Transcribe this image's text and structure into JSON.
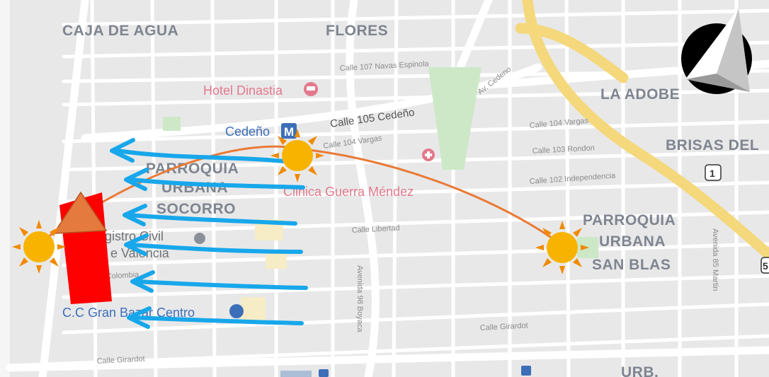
{
  "map": {
    "districts": [
      "CAJA DE AGUA",
      "FLORES",
      "LA ADOBE",
      "BRISAS DEL",
      "PARROQUIA",
      "URBANA",
      "SOCORRO",
      "PARROQUIA",
      "URBANA",
      "SAN BLAS",
      "URB."
    ],
    "streets": [
      "Calle 107 Navas Espinola",
      "Av. Cedeno",
      "Calle 105 Cedeño",
      "Calle 104 Vargas",
      "Calle 104 Vargas",
      "Calle 103 Rondon",
      "Calle 102 Independencia",
      "Calle Libertad",
      "Avenida 98 Boyaca",
      "Calle Girardot",
      "Calle Girardot",
      "Colombia",
      "Avenida 85 Martin"
    ],
    "pois": {
      "hotel": "Hotel Dinastia",
      "metro": "Cedeño",
      "clinic": "Clinica Guerra Méndez",
      "registry_1": "gistro Civil",
      "registry_2": "e Valencia",
      "mall": "C.C Gran Bazar Centro"
    },
    "route_shield": "1",
    "edge_shield": "5"
  },
  "overlay": {
    "icons": [
      "compass-icon",
      "sun-icon",
      "house-icon",
      "wind-arrow-icon"
    ],
    "colors": {
      "sun": "#f7b300",
      "sun_rays": "#f08a00",
      "sun_path": "#ea7a35",
      "wind": "#17a7ea",
      "building": "#ff0000",
      "roof": "#e47a3e"
    }
  }
}
